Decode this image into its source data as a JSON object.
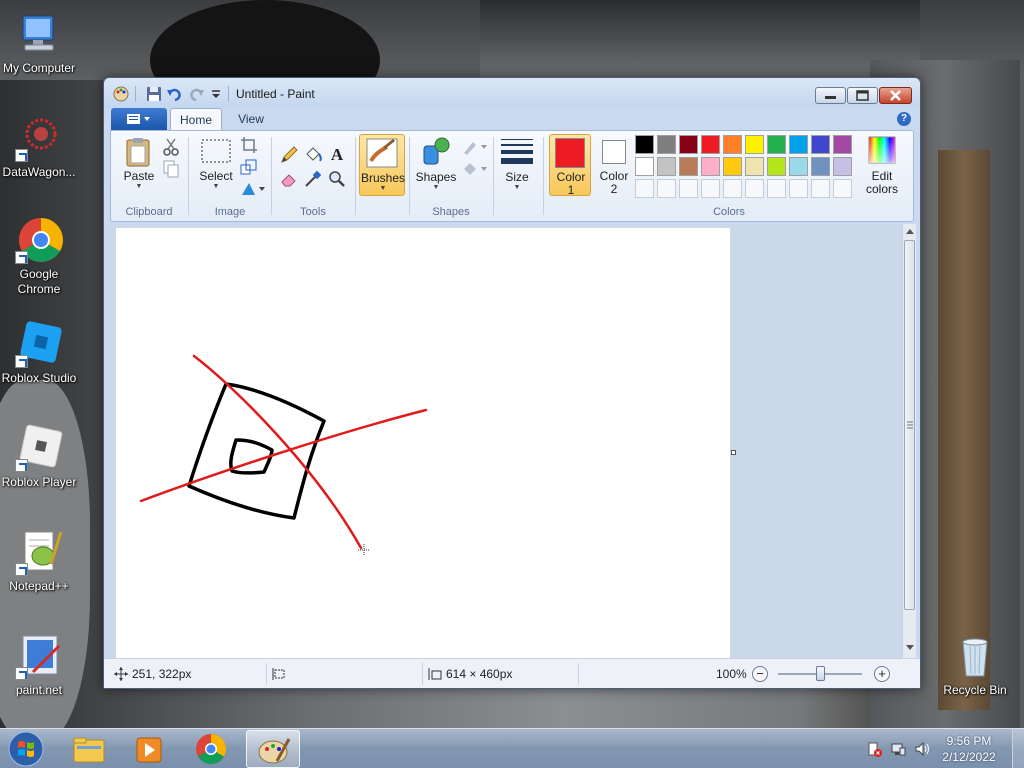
{
  "desktop": {
    "icons": [
      {
        "name": "my-computer",
        "label": "My Computer"
      },
      {
        "name": "datawagon",
        "label": "DataWagon..."
      },
      {
        "name": "google-chrome",
        "label": "Google\nChrome"
      },
      {
        "name": "roblox-studio",
        "label": "Roblox Studio"
      },
      {
        "name": "roblox-player",
        "label": "Roblox Player"
      },
      {
        "name": "notepad-plus-plus",
        "label": "Notepad++"
      },
      {
        "name": "paint-net",
        "label": "paint.net"
      },
      {
        "name": "recycle-bin",
        "label": "Recycle Bin"
      }
    ]
  },
  "window": {
    "title": "Untitled - Paint",
    "tabs": {
      "home": "Home",
      "view": "View"
    },
    "help": "?"
  },
  "ribbon": {
    "clipboard": {
      "paste": "Paste",
      "group": "Clipboard"
    },
    "image": {
      "select": "Select",
      "group": "Image"
    },
    "tools": {
      "group": "Tools",
      "text_tool": "A"
    },
    "brushes": {
      "label": "Brushes"
    },
    "shapes": {
      "label": "Shapes",
      "group": "Shapes"
    },
    "size": {
      "label": "Size"
    },
    "colors": {
      "color1": "Color\n1",
      "color2": "Color\n2",
      "edit": "Edit\ncolors",
      "group": "Colors",
      "color1_value": "#ed1c24",
      "color2_value": "#ffffff",
      "palette_row1": [
        "#000000",
        "#7f7f7f",
        "#880015",
        "#ed1c24",
        "#ff7f27",
        "#fff200",
        "#22b14c",
        "#00a2e8",
        "#3f48cc",
        "#a349a4"
      ],
      "palette_row2": [
        "#ffffff",
        "#c3c3c3",
        "#b97a57",
        "#ffaec9",
        "#ffc90e",
        "#efe4b0",
        "#b5e61d",
        "#99d9ea",
        "#7092be",
        "#c8bfe7"
      ]
    }
  },
  "status": {
    "cursor_pos": "251, 322px",
    "canvas_size": "614 × 460px",
    "zoom": "100%",
    "zoom_minus": "−",
    "zoom_plus": "+"
  },
  "taskbar": {
    "time": "9:56 PM",
    "date": "2/12/2022"
  }
}
